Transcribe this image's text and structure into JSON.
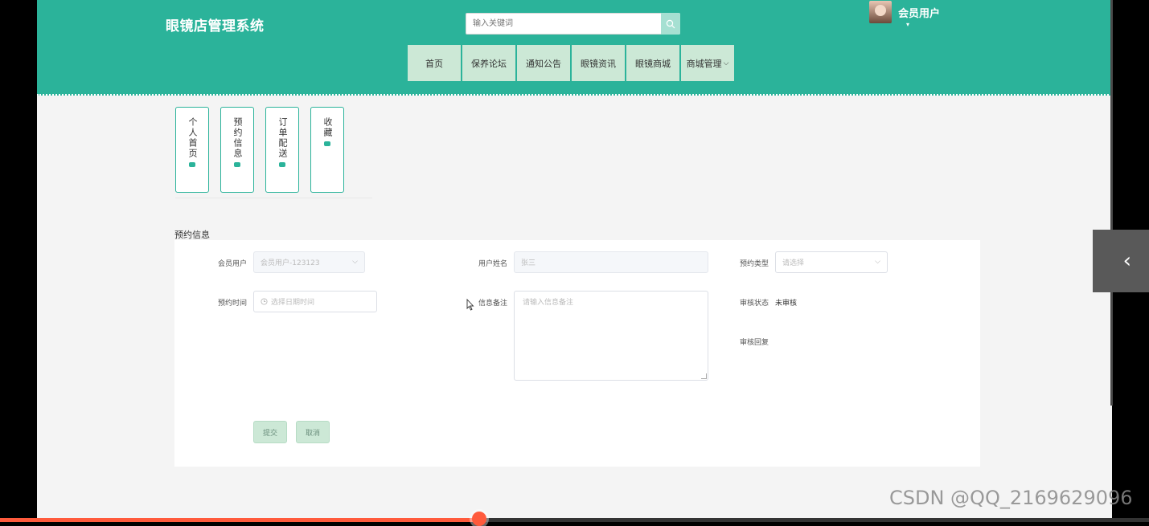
{
  "header": {
    "brand": "眼镜店管理系统",
    "search_placeholder": "输入关键词",
    "user_name": "会员用户",
    "user_caret": "▾",
    "nav": [
      "首页",
      "保养论坛",
      "通知公告",
      "眼镜资讯",
      "眼镜商城",
      "商城管理"
    ],
    "nav_dropdown_caret": "⌵"
  },
  "sidebar_tabs": [
    "个人首页",
    "预约信息",
    "订单配送",
    "收藏"
  ],
  "form": {
    "section_title": "预约信息",
    "member_label": "会员用户",
    "member_value": "会员用户-123123",
    "name_label": "用户姓名",
    "name_value": "张三",
    "type_label": "预约类型",
    "type_placeholder": "请选择",
    "time_label": "预约时间",
    "time_placeholder": "选择日期时间",
    "note_label": "信息备注",
    "note_placeholder": "请输入信息备注",
    "status_label": "审核状态",
    "status_value": "未审核",
    "reply_label": "审核回复",
    "submit_label": "提交",
    "cancel_label": "取消"
  },
  "overlay": {
    "collapse_glyph": "‹",
    "progress_fraction": 0.417,
    "watermark": "CSDN @QQ_2169629096"
  },
  "colors": {
    "primary": "#2bb39a",
    "nav_bg": "#cce8d6",
    "progress": "#ff5a3c"
  }
}
